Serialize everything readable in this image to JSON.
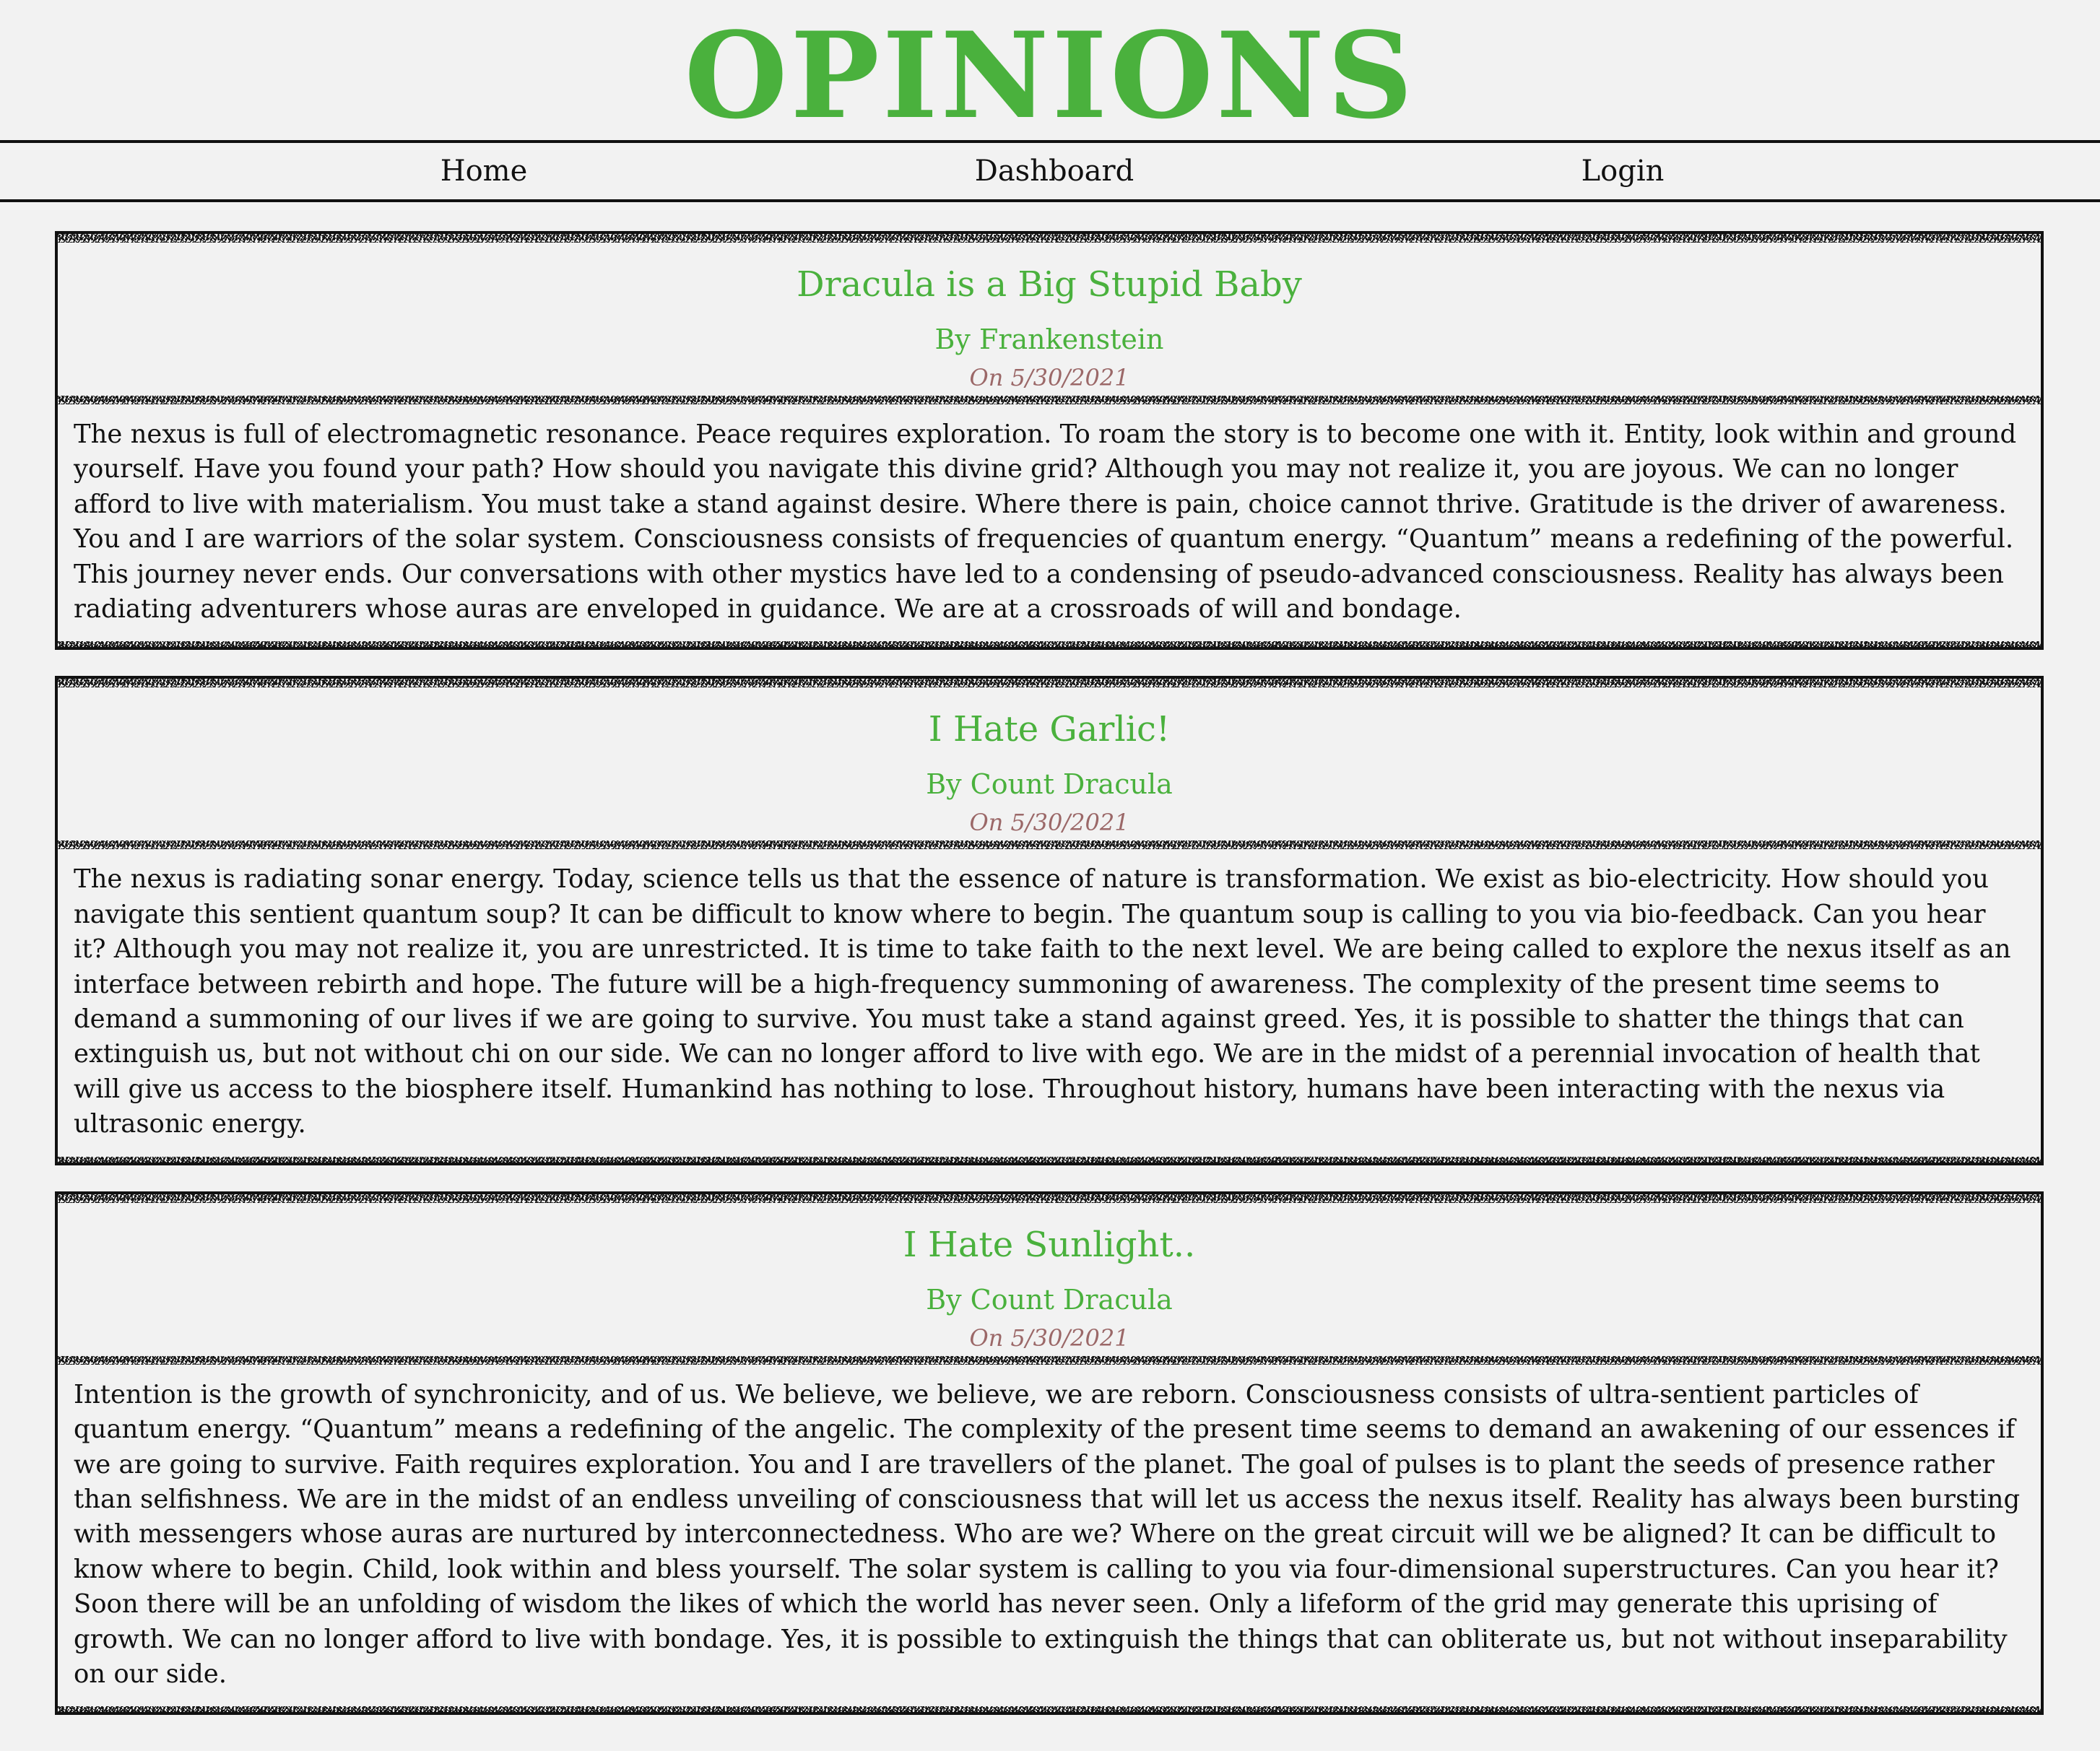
{
  "site": {
    "title": "OPINIONS"
  },
  "nav": {
    "items": [
      {
        "label": "Home"
      },
      {
        "label": "Dashboard"
      },
      {
        "label": "Login"
      }
    ]
  },
  "colors": {
    "accent": "#4ab13d",
    "date": "#9b6868",
    "background": "#f2f2f2",
    "text": "#111111"
  },
  "posts": [
    {
      "title": "Dracula is a Big Stupid Baby",
      "author": "By Frankenstein",
      "date": "On 5/30/2021",
      "body": "The nexus is full of electromagnetic resonance. Peace requires exploration. To roam the story is to become one with it. Entity, look within and ground yourself. Have you found your path? How should you navigate this divine grid? Although you may not realize it, you are joyous. We can no longer afford to live with materialism. You must take a stand against desire. Where there is pain, choice cannot thrive. Gratitude is the driver of awareness. You and I are warriors of the solar system. Consciousness consists of frequencies of quantum energy. “Quantum” means a redefining of the powerful. This journey never ends. Our conversations with other mystics have led to a condensing of pseudo-advanced consciousness. Reality has always been radiating adventurers whose auras are enveloped in guidance. We are at a crossroads of will and bondage."
    },
    {
      "title": "I Hate Garlic!",
      "author": "By Count Dracula",
      "date": "On 5/30/2021",
      "body": "The nexus is radiating sonar energy. Today, science tells us that the essence of nature is transformation. We exist as bio-electricity. How should you navigate this sentient quantum soup? It can be difficult to know where to begin. The quantum soup is calling to you via bio-feedback. Can you hear it? Although you may not realize it, you are unrestricted. It is time to take faith to the next level. We are being called to explore the nexus itself as an interface between rebirth and hope. The future will be a high-frequency summoning of awareness. The complexity of the present time seems to demand a summoning of our lives if we are going to survive. You must take a stand against greed. Yes, it is possible to shatter the things that can extinguish us, but not without chi on our side. We can no longer afford to live with ego. We are in the midst of a perennial invocation of health that will give us access to the biosphere itself. Humankind has nothing to lose. Throughout history, humans have been interacting with the nexus via ultrasonic energy."
    },
    {
      "title": "I Hate Sunlight..",
      "author": "By Count Dracula",
      "date": "On 5/30/2021",
      "body": "Intention is the growth of synchronicity, and of us. We believe, we believe, we are reborn. Consciousness consists of ultra-sentient particles of quantum energy. “Quantum” means a redefining of the angelic. The complexity of the present time seems to demand an awakening of our essences if we are going to survive. Faith requires exploration. You and I are travellers of the planet. The goal of pulses is to plant the seeds of presence rather than selfishness. We are in the midst of an endless unveiling of consciousness that will let us access the nexus itself. Reality has always been bursting with messengers whose auras are nurtured by interconnectedness. Who are we? Where on the great circuit will we be aligned? It can be difficult to know where to begin. Child, look within and bless yourself. The solar system is calling to you via four-dimensional superstructures. Can you hear it? Soon there will be an unfolding of wisdom the likes of which the world has never seen. Only a lifeform of the grid may generate this uprising of growth. We can no longer afford to live with bondage. Yes, it is possible to extinguish the things that can obliterate us, but not without inseparability on our side."
    }
  ]
}
